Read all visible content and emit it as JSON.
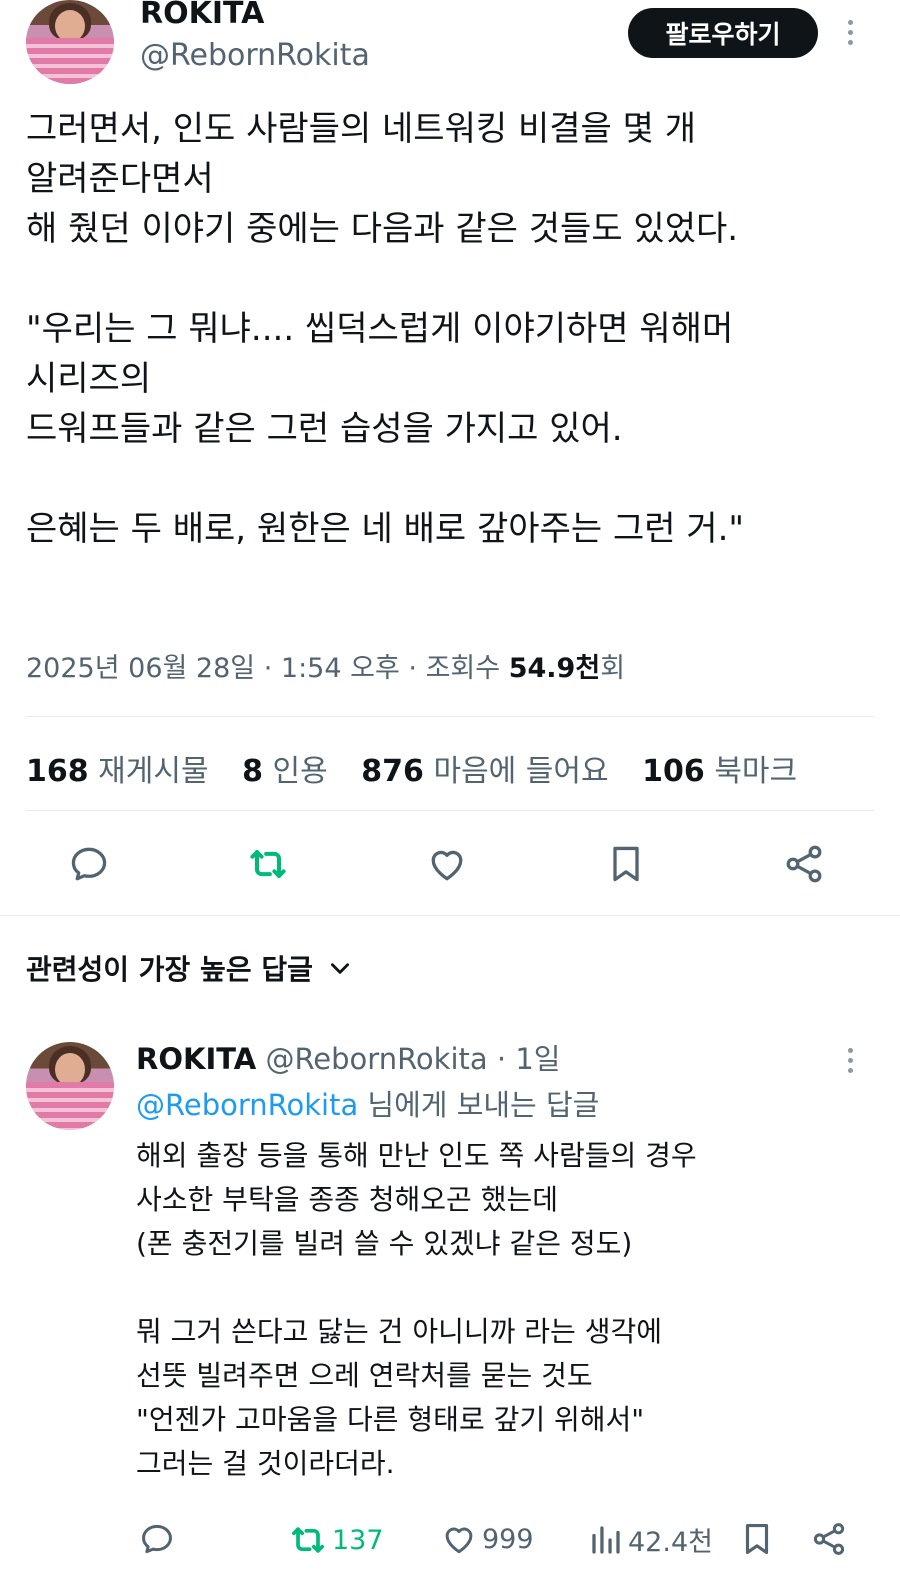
{
  "tweet": {
    "author": {
      "name": "ROKITA",
      "handle": "@RebornRokita"
    },
    "follow_label": "팔로우하기",
    "text": "그러면서, 인도 사람들의 네트워킹 비결을 몇 개\n알려준다면서\n해 줬던 이야기 중에는 다음과 같은 것들도 있었다.\n\n\"우리는 그 뭐냐.... 씹덕스럽게 이야기하면 워해머\n시리즈의\n드워프들과 같은 그런 습성을 가지고 있어.\n\n은혜는 두 배로, 원한은 네 배로 갚아주는 그런 거.\"",
    "meta": {
      "date": "2025년 06월 28일",
      "sep": "·",
      "time": "1:54 오후",
      "views_label": "조회수",
      "views_value": "54.9천",
      "views_suffix": "회"
    },
    "stats": [
      {
        "count": "168",
        "label": "재게시물"
      },
      {
        "count": "8",
        "label": "인용"
      },
      {
        "count": "876",
        "label": "마음에 들어요"
      },
      {
        "count": "106",
        "label": "북마크"
      }
    ],
    "action_icons": [
      "reply-icon",
      "retweet-icon",
      "like-icon",
      "bookmark-icon",
      "share-icon"
    ]
  },
  "sort": {
    "label": "관련성이 가장 높은 답글"
  },
  "reply": {
    "name": "ROKITA",
    "handle": "@RebornRokita",
    "time": "· 1일",
    "reply_to_handle": "@RebornRokita",
    "reply_to_suffix": " 님에게 보내는 답글",
    "text": "해외 출장 등을 통해 만난 인도 쪽 사람들의 경우\n사소한 부탁을 종종 청해오곤 했는데\n(폰 충전기를 빌려 쓸 수 있겠냐 같은 정도)\n\n뭐 그거 쓴다고 닳는 건 아니니까 라는 생각에\n선뜻 빌려주면 으레 연락처를 묻는 것도\n\"언젠가 고마움을 다른 형태로 갚기 위해서\"\n그러는 걸 것이라더라.",
    "retweets": "137",
    "likes": "999",
    "views": "42.4천"
  },
  "colors": {
    "accent_blue": "#1d9bf0",
    "retweet_green": "#00ba7c",
    "text": "#0f1419",
    "muted": "#536471"
  }
}
